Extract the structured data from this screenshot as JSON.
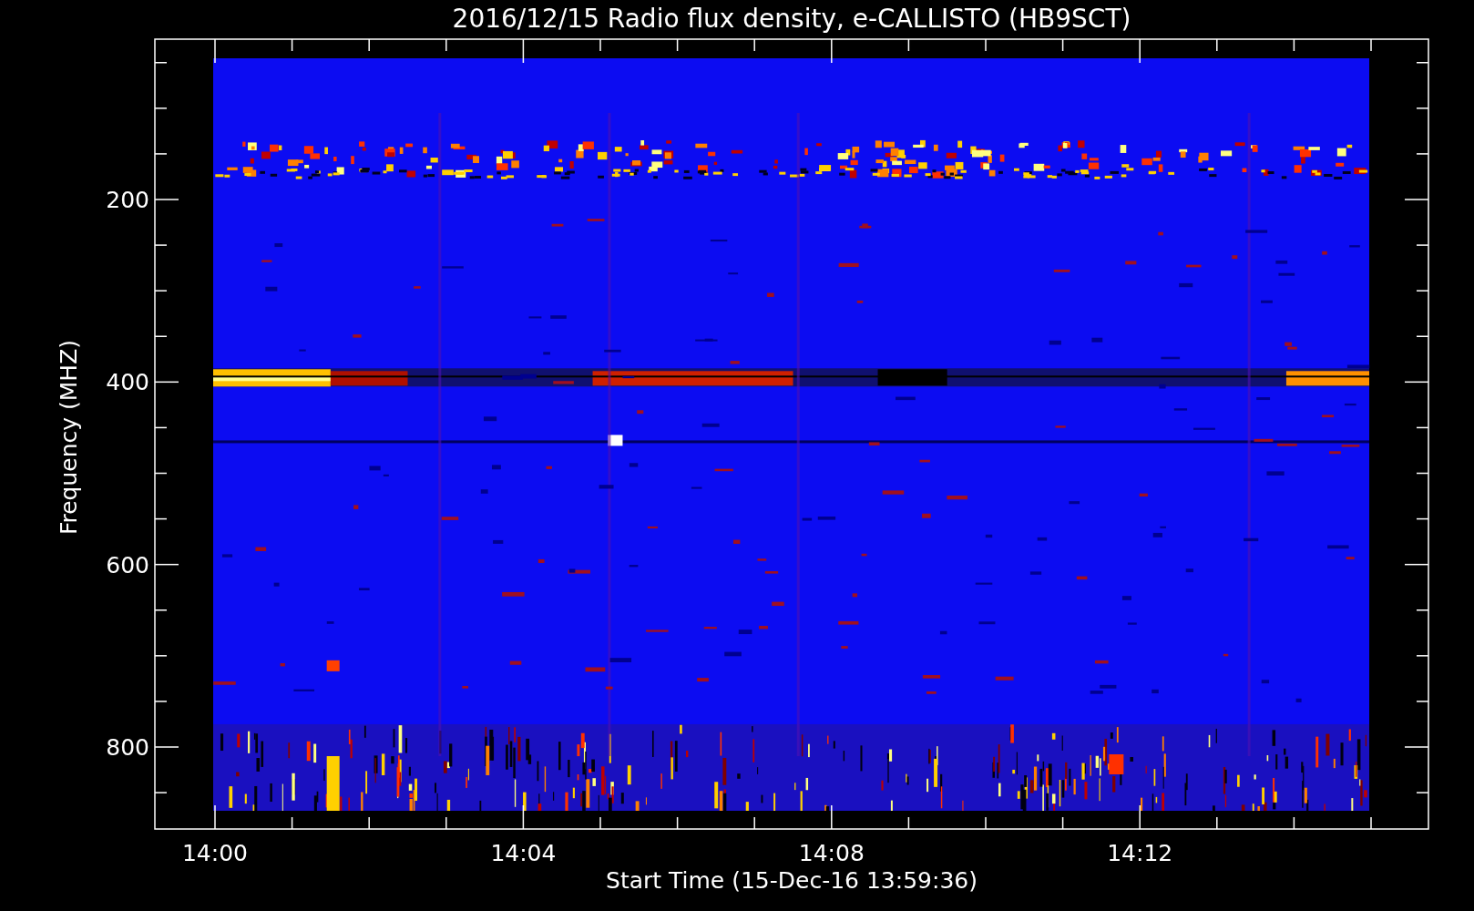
{
  "plot": {
    "title": "2016/12/15  Radio flux density, e-CALLISTO (HB9SCT)",
    "ylabel": "Frequency (MHZ)",
    "xlabel": "Start Time (15-Dec-16 13:59:36)",
    "yticks": [
      "200",
      "400",
      "600",
      "800"
    ],
    "xticks": [
      "14:00",
      "14:04",
      "14:08",
      "14:12"
    ]
  }
}
